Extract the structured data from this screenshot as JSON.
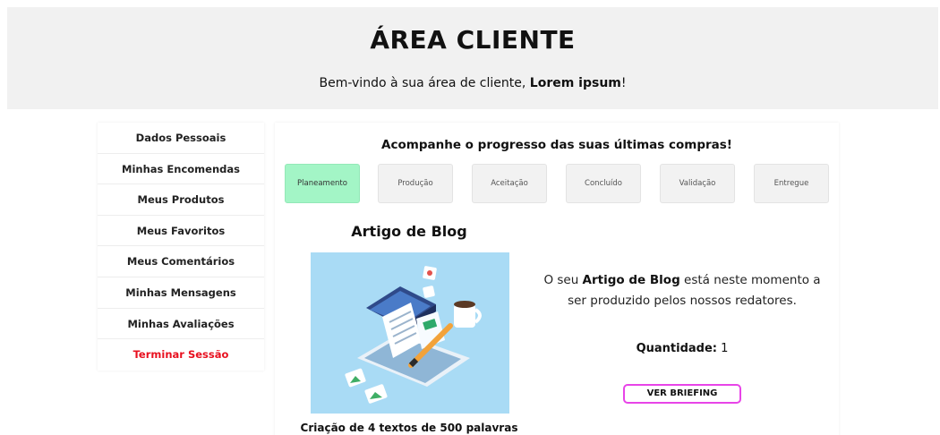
{
  "header": {
    "title": "ÁREA CLIENTE",
    "welcome_prefix": "Bem-vindo à sua área de cliente, ",
    "user_name": "Lorem ipsum",
    "welcome_suffix": "!"
  },
  "sidebar": {
    "items": [
      {
        "label": "Dados Pessoais"
      },
      {
        "label": "Minhas Encomendas"
      },
      {
        "label": "Meus Produtos"
      },
      {
        "label": "Meus Favoritos"
      },
      {
        "label": "Meus Comentários"
      },
      {
        "label": "Minhas Mensagens"
      },
      {
        "label": "Minhas Avaliações"
      },
      {
        "label": "Terminar Sessão"
      }
    ]
  },
  "progress": {
    "title": "Acompanhe o progresso das suas últimas compras!",
    "active_color": "#a3f5c6",
    "steps": [
      {
        "label": "Planeamento",
        "active": true
      },
      {
        "label": "Produção",
        "active": false
      },
      {
        "label": "Aceitação",
        "active": false
      },
      {
        "label": "Concluído",
        "active": false
      },
      {
        "label": "Validação",
        "active": false
      },
      {
        "label": "Entregue",
        "active": false
      }
    ]
  },
  "product": {
    "name": "Artigo de Blog",
    "image_icon": "blog-article-illustration",
    "description": "Criação de 4 textos de 500 palavras",
    "status_prefix": "O seu ",
    "status_product": "Artigo de Blog",
    "status_suffix": " está neste momento a ser produzido pelos nossos redatores.",
    "quantity_label": "Quantidade:",
    "quantity_value": "1",
    "briefing_button": "VER BRIEFING",
    "briefing_border_color": "#e844e8"
  },
  "colors": {
    "header_bg": "#f1f1f1",
    "logout_red": "#e8101f"
  }
}
